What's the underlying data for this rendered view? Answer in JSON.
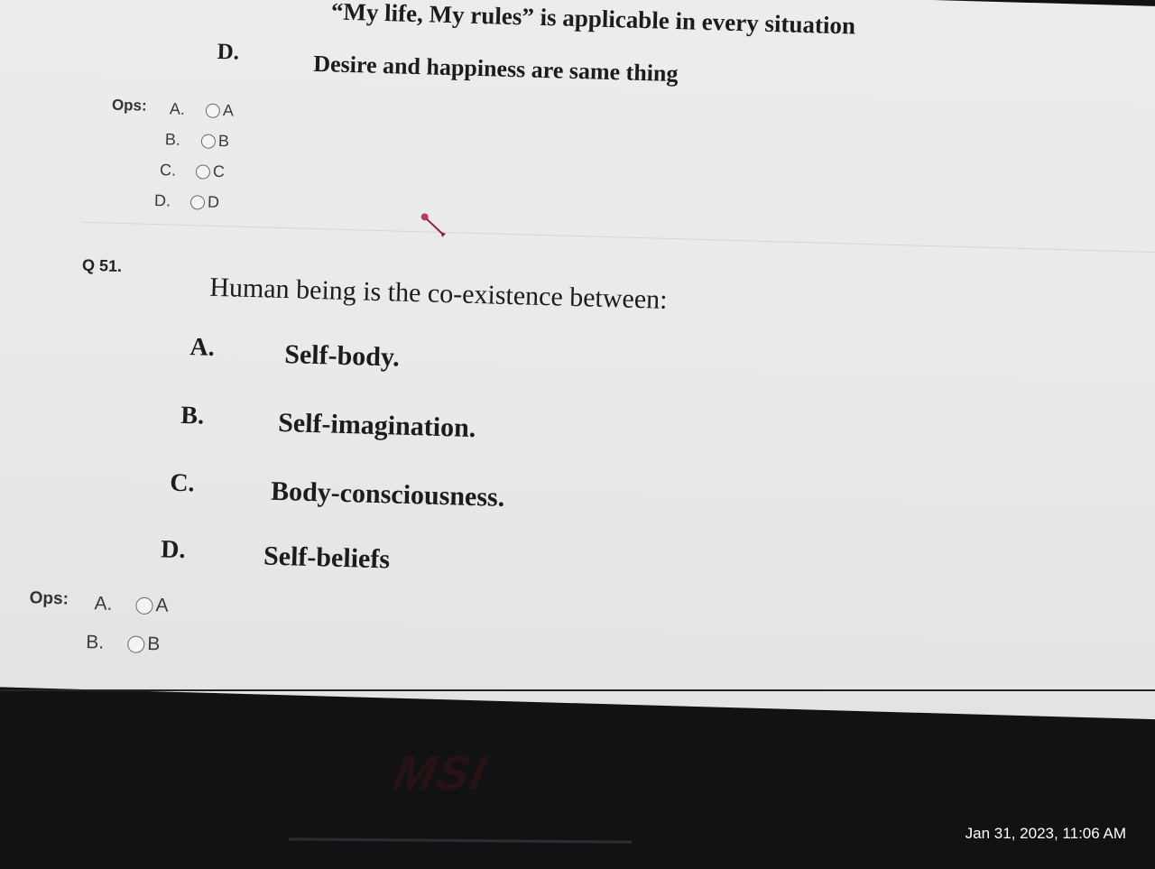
{
  "prev_question": {
    "option_c_text": "“My life, My rules” is applicable in every situation",
    "option_d_letter": "D.",
    "option_d_text": "Desire and happiness are same thing",
    "ops_label": "Ops:",
    "choices": [
      {
        "letter": "A.",
        "value": "A"
      },
      {
        "letter": "B.",
        "value": "B"
      },
      {
        "letter": "C.",
        "value": "C"
      },
      {
        "letter": "D.",
        "value": "D"
      }
    ]
  },
  "question": {
    "number": "Q 51.",
    "text": "Human being is the co-existence between:",
    "options": [
      {
        "letter": "A.",
        "text": "Self-body."
      },
      {
        "letter": "B.",
        "text": "Self-imagination."
      },
      {
        "letter": "C.",
        "text": "Body-consciousness."
      },
      {
        "letter": "D.",
        "text": "Self-beliefs"
      }
    ],
    "ops_label": "Ops:",
    "choices": [
      {
        "letter": "A.",
        "value": "A"
      },
      {
        "letter": "B.",
        "value": "B"
      }
    ]
  },
  "bezel": {
    "brand": "MSI"
  },
  "photo": {
    "timestamp": "Jan 31, 2023, 11:06 AM"
  },
  "colors": {
    "screen_bg": "#ececed",
    "text": "#1c1c1c",
    "bezel": "#121214",
    "cursor": "#c0395a"
  }
}
